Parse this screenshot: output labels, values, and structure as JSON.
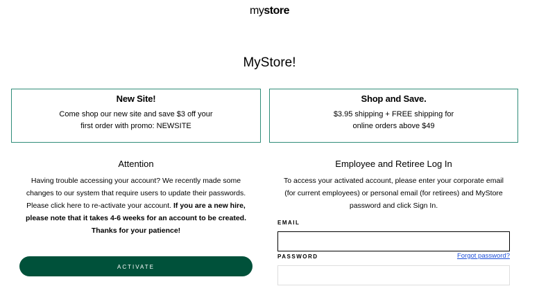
{
  "header": {
    "logo_my": "my",
    "logo_store": "store"
  },
  "page_title": "MyStore!",
  "promos": [
    {
      "title": "New Site!",
      "line1": "Come shop our new site and save $3 off your",
      "line2": "first order with promo: NEWSITE"
    },
    {
      "title": "Shop and Save.",
      "line1": "$3.95 shipping + FREE shipping for",
      "line2": "online orders above $49"
    }
  ],
  "attention": {
    "heading": "Attention",
    "text_regular": "Having trouble accessing your account? We recently made some changes to our system that require users to update their passwords. Please click here to re-activate your account. ",
    "text_bold": "If you are a new hire, please note that it takes 4-6 weeks for an account to be created. Thanks for your patience!",
    "activate_label": "ACTIVATE"
  },
  "login": {
    "heading": "Employee and Retiree Log In",
    "description": "To access your activated account, please enter your corporate email (for current employees) or personal email (for retirees) and MyStore password and click Sign In.",
    "email_label": "EMAIL",
    "email_value": "",
    "password_label": "PASSWORD",
    "password_value": "",
    "forgot_label": "Forgot password?"
  },
  "colors": {
    "accent": "#00513a",
    "promo_border": "#2f8c78",
    "link": "#1d4fd8"
  }
}
